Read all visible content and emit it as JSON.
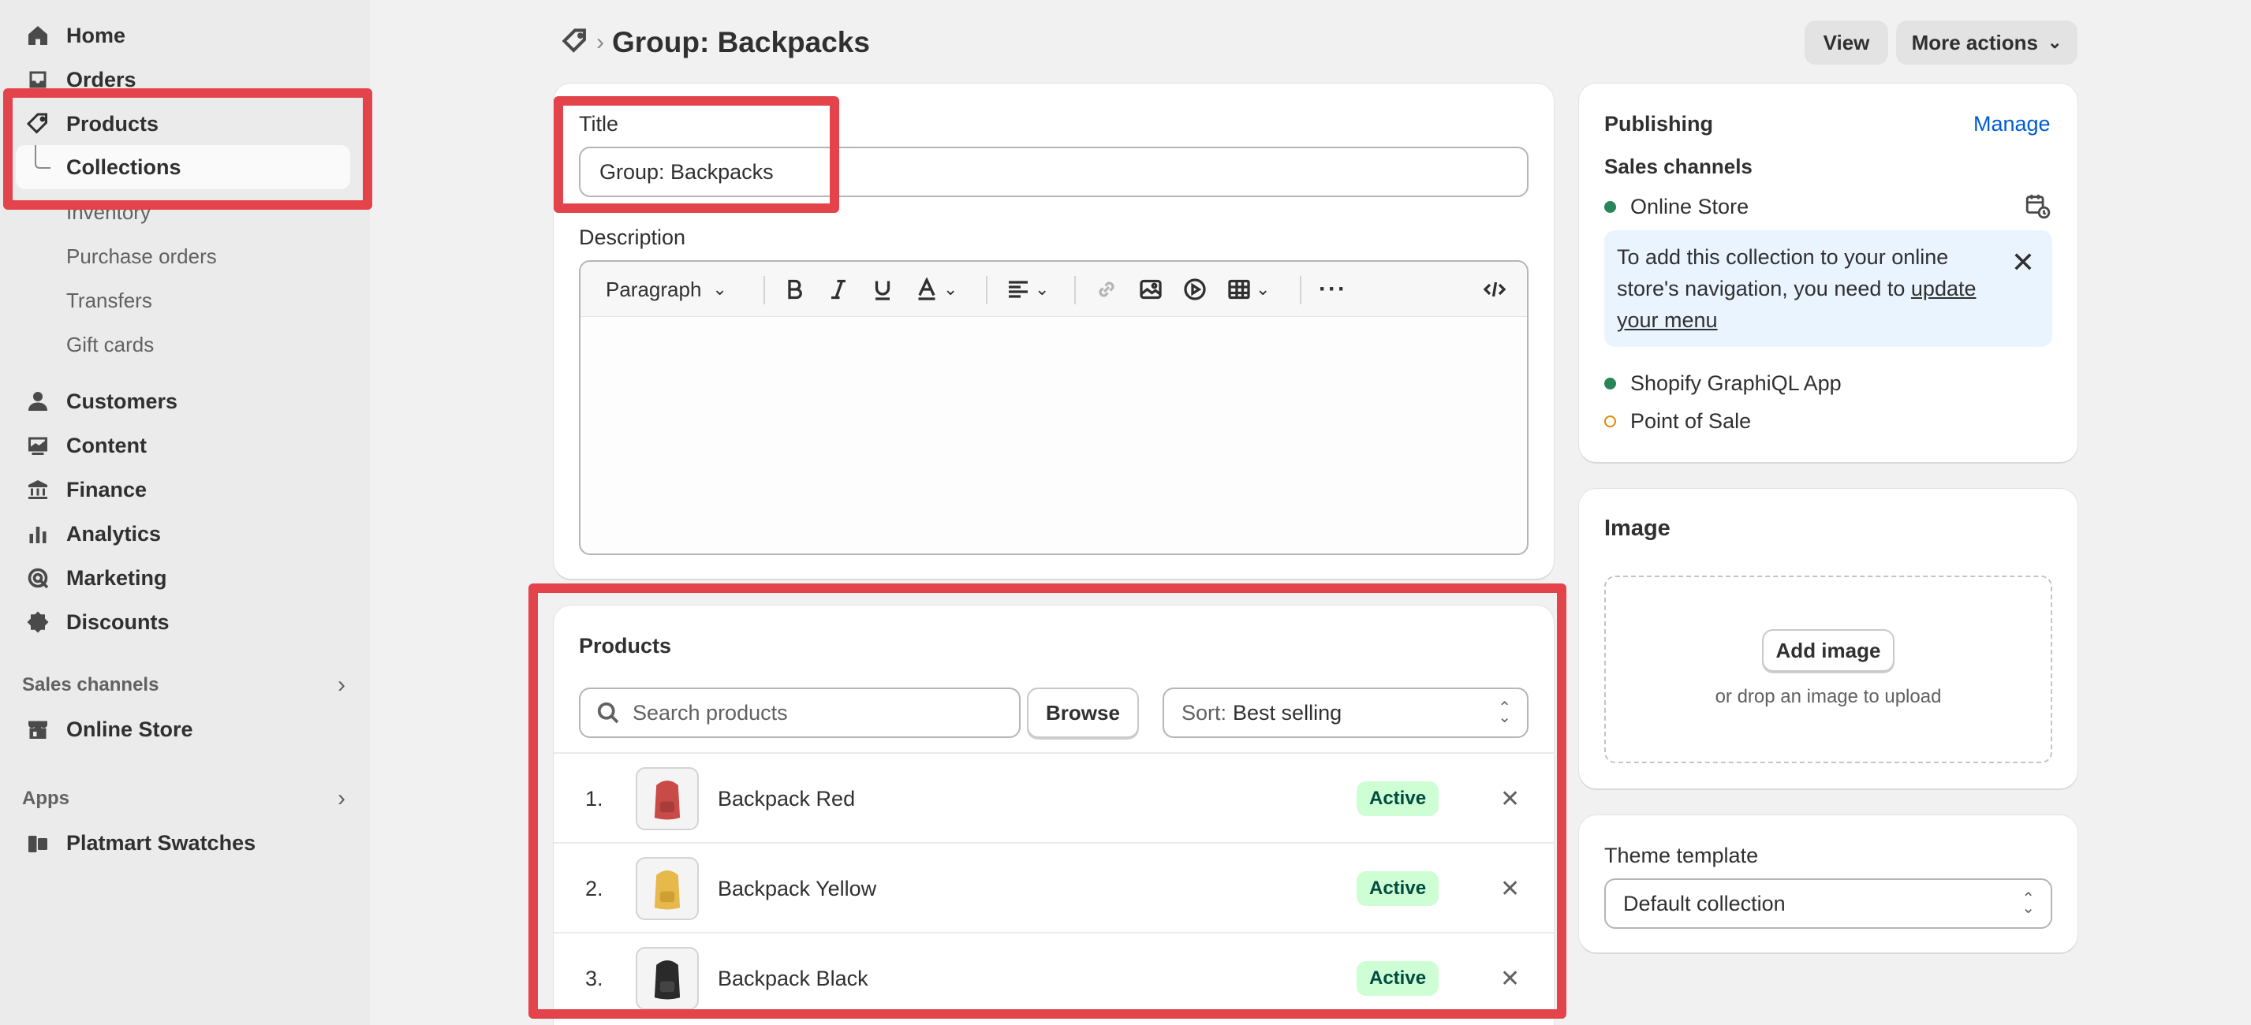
{
  "sidebar": {
    "nav": [
      {
        "label": "Home",
        "icon": "home-icon"
      },
      {
        "label": "Orders",
        "icon": "inbox-icon"
      },
      {
        "label": "Products",
        "icon": "tag-icon"
      }
    ],
    "product_sub": {
      "collections": "Collections",
      "inventory": "Inventory",
      "purchase_orders": "Purchase orders",
      "transfers": "Transfers",
      "gift_cards": "Gift cards"
    },
    "nav2": [
      {
        "label": "Customers",
        "icon": "person-icon"
      },
      {
        "label": "Content",
        "icon": "content-icon"
      },
      {
        "label": "Finance",
        "icon": "bank-icon"
      },
      {
        "label": "Analytics",
        "icon": "bar-chart-icon"
      },
      {
        "label": "Marketing",
        "icon": "target-icon"
      },
      {
        "label": "Discounts",
        "icon": "discount-icon"
      }
    ],
    "sales_channels": "Sales channels",
    "online_store": "Online Store",
    "apps": "Apps",
    "platmart": "Platmart Swatches"
  },
  "header": {
    "title": "Group: Backpacks",
    "view": "View",
    "more_actions": "More actions"
  },
  "details": {
    "title_label": "Title",
    "title_value": "Group: Backpacks",
    "description_label": "Description",
    "paragraph": "Paragraph"
  },
  "products": {
    "heading": "Products",
    "search_placeholder": "Search products",
    "browse": "Browse",
    "sort_prefix": "Sort:",
    "sort_value": "Best selling",
    "items": [
      {
        "num": "1.",
        "name": "Backpack Red",
        "status": "Active",
        "color": "#c94b48"
      },
      {
        "num": "2.",
        "name": "Backpack Yellow",
        "status": "Active",
        "color": "#e7b84a"
      },
      {
        "num": "3.",
        "name": "Backpack Black",
        "status": "Active",
        "color": "#2a2a2a"
      }
    ]
  },
  "publishing": {
    "heading": "Publishing",
    "manage": "Manage",
    "sales_channels": "Sales channels",
    "online_store": "Online Store",
    "banner_text": "To add this collection to your online store's navigation, you need to ",
    "banner_link": "update your menu",
    "graphiql": "Shopify GraphiQL App",
    "pos": "Point of Sale"
  },
  "image": {
    "heading": "Image",
    "add_image": "Add image",
    "hint": "or drop an image to upload"
  },
  "theme": {
    "label": "Theme template",
    "value": "Default collection"
  },
  "colors": {
    "highlight": "#e3434b",
    "active_green": "#29845a",
    "pos_orange": "#e08a00",
    "link_blue": "#005bd3"
  }
}
